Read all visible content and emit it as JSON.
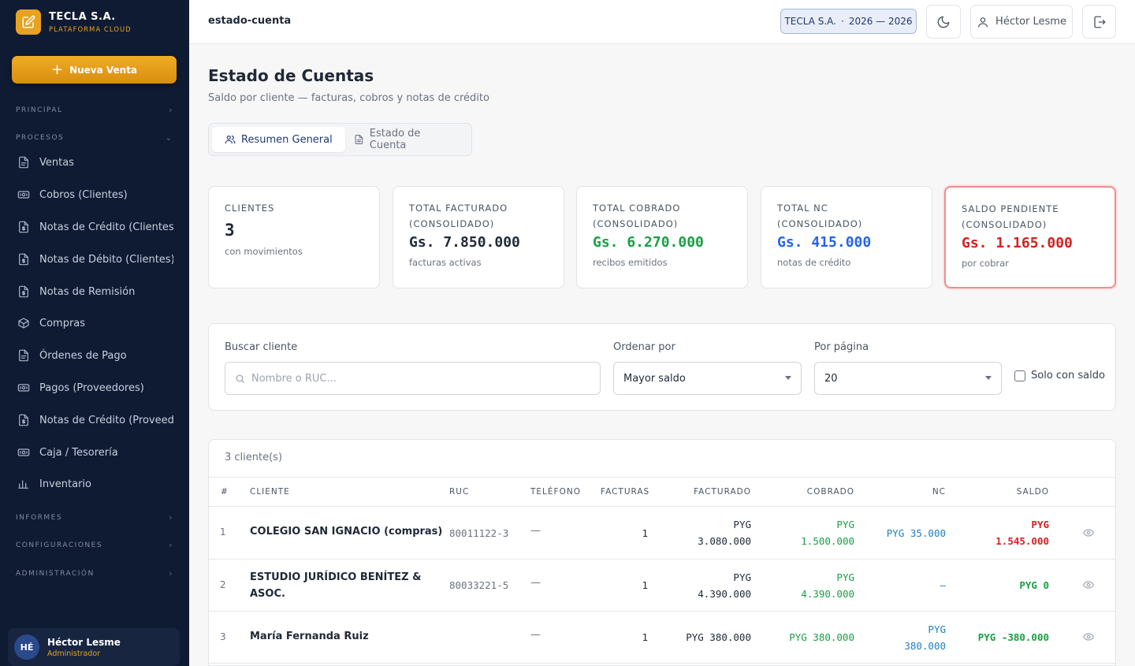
{
  "sidebar": {
    "brand_name": "TECLA S.A.",
    "brand_sub": "PLATAFORMA CLOUD",
    "new_sale": "Nueva Venta",
    "sections": {
      "principal": "PRINCIPAL",
      "procesos": "PROCESOS",
      "informes": "INFORMES",
      "configuraciones": "CONFIGURACIONES",
      "administracion": "ADMINISTRACIÓN"
    },
    "items": [
      {
        "label": "Ventas",
        "icon": "file-icon"
      },
      {
        "label": "Cobros (Clientes)",
        "icon": "cash-icon"
      },
      {
        "label": "Notas de Crédito (Clientes)",
        "icon": "file-dollar-icon"
      },
      {
        "label": "Notas de Débito (Clientes)",
        "icon": "file-dollar-icon"
      },
      {
        "label": "Notas de Remisión",
        "icon": "file-dollar-icon"
      },
      {
        "label": "Compras",
        "icon": "box-icon"
      },
      {
        "label": "Órdenes de Pago",
        "icon": "file-icon"
      },
      {
        "label": "Pagos (Proveedores)",
        "icon": "cash-icon"
      },
      {
        "label": "Notas de Crédito (Proveedores)",
        "icon": "file-dollar-icon"
      },
      {
        "label": "Caja / Tesorería",
        "icon": "cash-icon"
      },
      {
        "label": "Inventario",
        "icon": "bar-chart-icon"
      }
    ],
    "user": {
      "initials": "HÉ",
      "name": "Héctor Lesme",
      "role": "Administrador"
    }
  },
  "topbar": {
    "route": "estado-cuenta",
    "company": "TECLA S.A.",
    "separator": "·",
    "period": "2026 — 2026",
    "user": "Héctor Lesme"
  },
  "page": {
    "title": "Estado de Cuentas",
    "subtitle": "Saldo por cliente — facturas, cobros y notas de crédito",
    "tabs": [
      "Resumen General",
      "Estado de Cuenta"
    ]
  },
  "cards": [
    {
      "label": "CLIENTES",
      "value": "3",
      "note": "con movimientos",
      "color": "#1f2937"
    },
    {
      "label": "TOTAL FACTURADO (CONSOLIDADO)",
      "value": "Gs. 7.850.000",
      "note": "facturas activas",
      "color": "#1f2937"
    },
    {
      "label": "TOTAL COBRADO (CONSOLIDADO)",
      "value": "Gs. 6.270.000",
      "note": "recibos emitidos",
      "color": "#18a043"
    },
    {
      "label": "TOTAL NC (CONSOLIDADO)",
      "value": "Gs. 415.000",
      "note": "notas de crédito",
      "color": "#2563eb"
    },
    {
      "label": "SALDO PENDIENTE (CONSOLIDADO)",
      "value": "Gs. 1.165.000",
      "note": "por cobrar",
      "color": "#d62020"
    }
  ],
  "filters": {
    "search_label": "Buscar cliente",
    "search_placeholder": "Nombre o RUC...",
    "order_label": "Ordenar por",
    "order_value": "Mayor saldo",
    "per_page_label": "Por página",
    "per_page_value": "20",
    "only_balance": "Solo con saldo"
  },
  "table": {
    "count": "3 cliente(s)",
    "headers": [
      "#",
      "CLIENTE",
      "RUC",
      "TELÉFONO",
      "FACTURAS",
      "FACTURADO",
      "COBRADO",
      "NC",
      "SALDO"
    ],
    "rows": [
      {
        "n": "1",
        "client": [
          "COLEGIO SAN IGNACIO (compras)"
        ],
        "ruc": "80011122-3",
        "phone": "—",
        "invoices": "1",
        "billed": [
          "PYG",
          "3.080.000"
        ],
        "collected": [
          "PYG",
          "1.500.000"
        ],
        "nc": [
          "PYG 35.000"
        ],
        "balance": [
          "PYG",
          "1.545.000"
        ],
        "balance_color": "red"
      },
      {
        "n": "2",
        "client": [
          "ESTUDIO JURÍDICO BENÍTEZ &",
          "ASOC."
        ],
        "ruc": "80033221-5",
        "phone": "—",
        "invoices": "1",
        "billed": [
          "PYG",
          "4.390.000"
        ],
        "collected": [
          "PYG",
          "4.390.000"
        ],
        "nc": [
          "—"
        ],
        "balance": [
          "PYG 0"
        ],
        "balance_color": "green"
      },
      {
        "n": "3",
        "client": [
          "María Fernanda Ruiz"
        ],
        "ruc": "",
        "phone": "—",
        "invoices": "1",
        "billed": [
          "PYG 380.000"
        ],
        "collected": [
          "PYG 380.000"
        ],
        "nc": [
          "PYG",
          "380.000"
        ],
        "balance": [
          "PYG -380.000"
        ],
        "balance_color": "green"
      }
    ]
  }
}
